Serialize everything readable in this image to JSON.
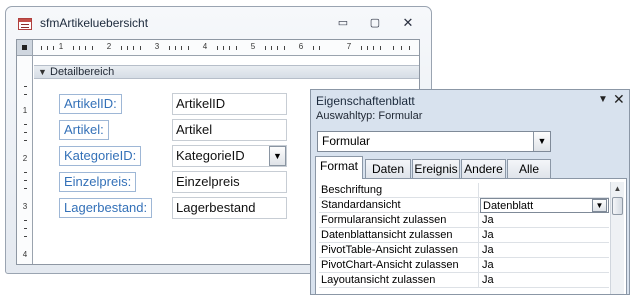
{
  "form_window": {
    "title": "sfmArtikeluebersicht",
    "icon": "form-icon",
    "controls": {
      "minimize": "▭",
      "maximize": "▢",
      "close": "✕"
    }
  },
  "rulers": {
    "horizontal_numbers": [
      "1",
      "2",
      "3",
      "4",
      "5",
      "6",
      "7"
    ],
    "vertical_numbers": [
      "1",
      "2",
      "3",
      "4"
    ]
  },
  "section": {
    "arrow": "▼",
    "label": "Detailbereich"
  },
  "fields": [
    {
      "label": "ArtikelID:",
      "value": "ArtikelID",
      "combo": false
    },
    {
      "label": "Artikel:",
      "value": "Artikel",
      "combo": false
    },
    {
      "label": "KategorieID:",
      "value": "KategorieID",
      "combo": true
    },
    {
      "label": "Einzelpreis:",
      "value": "Einzelpreis",
      "combo": false
    },
    {
      "label": "Lagerbestand:",
      "value": "Lagerbestand",
      "combo": false
    }
  ],
  "combo_arrow": "▼",
  "property_sheet": {
    "title": "Eigenschaftenblatt",
    "dropdown_arrow": "▼",
    "close_glyph": "✕",
    "selection_type": "Auswahltyp:  Formular",
    "object_combo": {
      "value": "Formular",
      "arrow": "▼"
    },
    "tabs": [
      {
        "label": "Format",
        "active": true
      },
      {
        "label": "Daten",
        "active": false
      },
      {
        "label": "Ereignis",
        "active": false
      },
      {
        "label": "Andere",
        "active": false
      },
      {
        "label": "Alle",
        "active": false
      }
    ],
    "rows": [
      {
        "name": "Beschriftung",
        "value": ""
      },
      {
        "name": "Standardansicht",
        "value": "Datenblatt",
        "selected": true
      },
      {
        "name": "Formularansicht zulassen",
        "value": "Ja"
      },
      {
        "name": "Datenblattansicht zulassen",
        "value": "Ja"
      },
      {
        "name": "PivotTable-Ansicht zulassen",
        "value": "Ja"
      },
      {
        "name": "PivotChart-Ansicht zulassen",
        "value": "Ja"
      },
      {
        "name": "Layoutansicht zulassen",
        "value": "Ja"
      }
    ],
    "scroll_up_arrow": "▲"
  }
}
